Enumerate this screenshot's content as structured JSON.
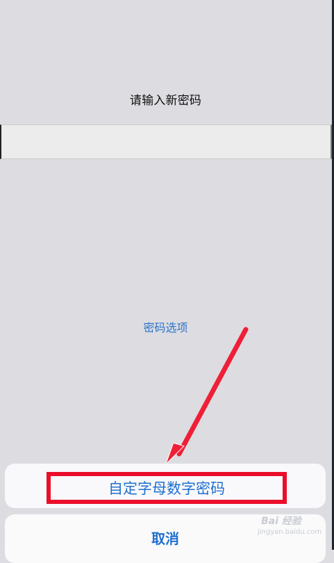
{
  "screen": {
    "prompt": "请输入新密码",
    "password_input": "",
    "options_link": "密码选项"
  },
  "action_sheet": {
    "option_label": "自定字母数字密码",
    "cancel_label": "取消"
  },
  "watermark": {
    "brand": "Bai 经验",
    "url": "jingyan.baidu.com"
  },
  "colors": {
    "accent": "#1f6fce",
    "highlight": "#ea0e2b"
  }
}
